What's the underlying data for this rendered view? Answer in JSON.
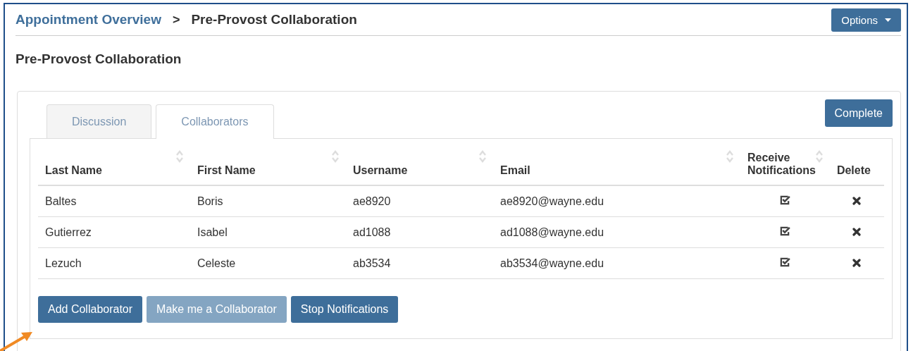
{
  "breadcrumb": {
    "link": "Appointment Overview",
    "separator": ">",
    "current": "Pre-Provost Collaboration"
  },
  "options_button": "Options",
  "page_title": "Pre-Provost Collaboration",
  "tabs": [
    {
      "label": "Discussion",
      "selected": false
    },
    {
      "label": "Collaborators",
      "selected": true
    }
  ],
  "complete_button": "Complete",
  "table": {
    "columns": [
      {
        "label": "Last Name",
        "sortable": true
      },
      {
        "label": "First Name",
        "sortable": true
      },
      {
        "label": "Username",
        "sortable": true
      },
      {
        "label": "Email",
        "sortable": true
      },
      {
        "label": "Receive Notifications",
        "sortable": true
      },
      {
        "label": "Delete",
        "sortable": false
      }
    ],
    "rows": [
      {
        "last_name": "Baltes",
        "first_name": "Boris",
        "username": "ae8920",
        "email": "ae8920@wayne.edu",
        "receive_notifications": true
      },
      {
        "last_name": "Gutierrez",
        "first_name": "Isabel",
        "username": "ad1088",
        "email": "ad1088@wayne.edu",
        "receive_notifications": true
      },
      {
        "last_name": "Lezuch",
        "first_name": "Celeste",
        "username": "ab3534",
        "email": "ab3534@wayne.edu",
        "receive_notifications": true
      }
    ]
  },
  "buttons": [
    {
      "label": "Add Collaborator",
      "disabled": false
    },
    {
      "label": "Make me a Collaborator",
      "disabled": true
    },
    {
      "label": "Stop Notifications",
      "disabled": false
    }
  ]
}
